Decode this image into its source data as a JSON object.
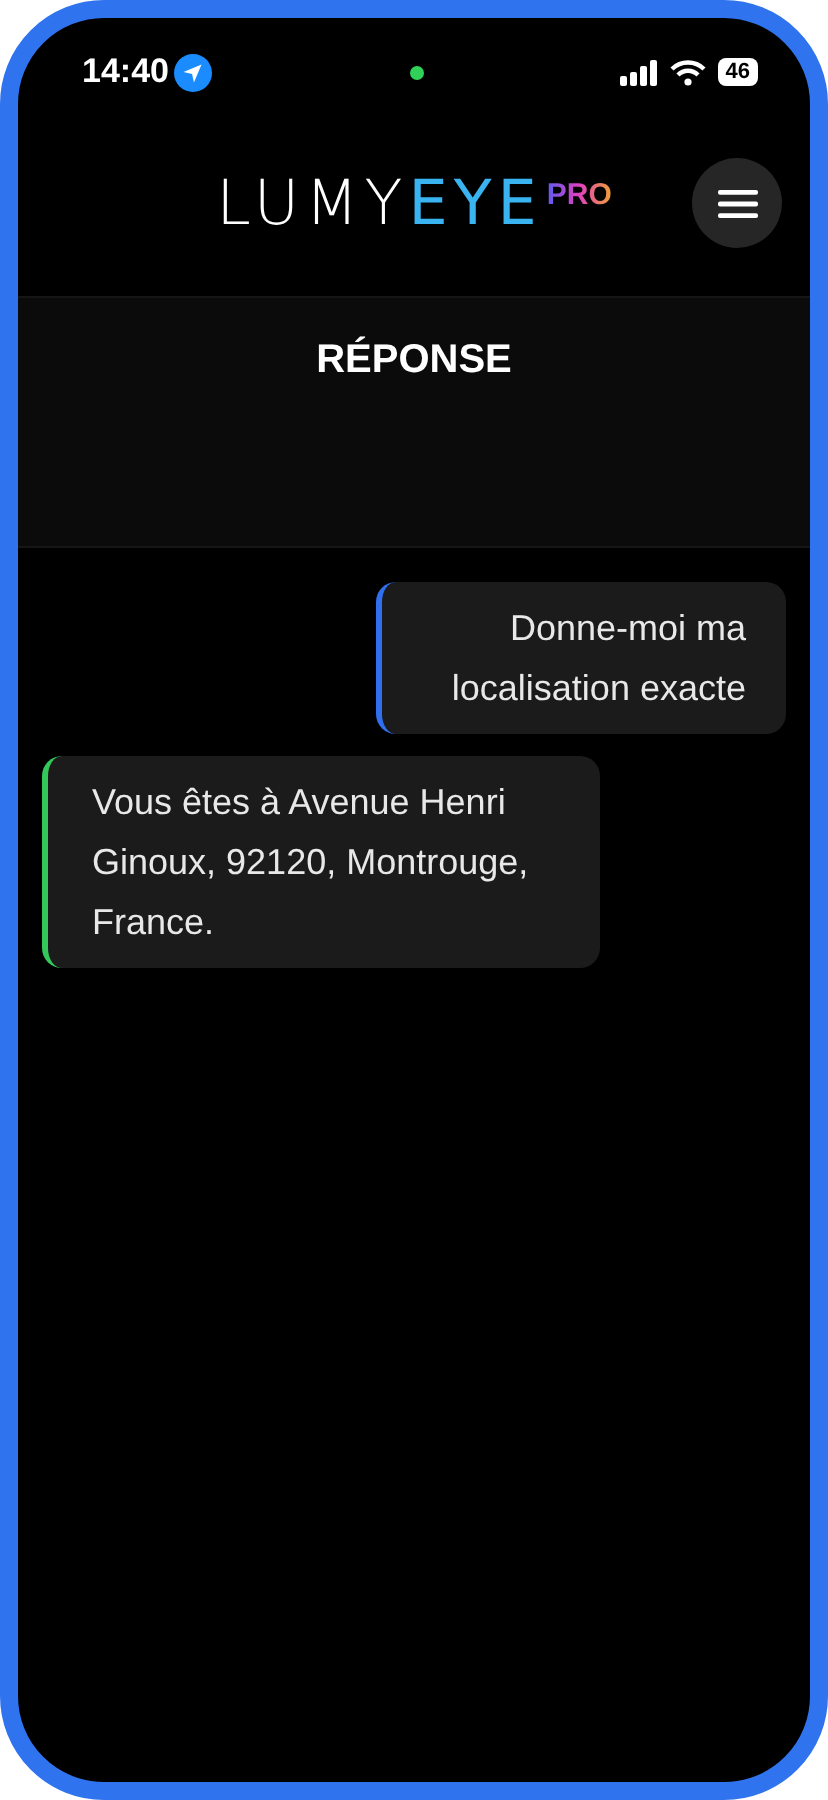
{
  "status_bar": {
    "time": "14:40",
    "battery": "46"
  },
  "logo": {
    "main": "LUMY",
    "accent": "EYE",
    "badge": "PRO"
  },
  "section": {
    "title": "RÉPONSE"
  },
  "messages": [
    {
      "kind": "user",
      "text": "Donne-moi ma localisation exacte",
      "color": "#2f6ff0"
    },
    {
      "kind": "assistant",
      "text": "Vous êtes à Avenue Henri Ginoux, 92120, Montrouge, France.",
      "color": "#34c759"
    }
  ]
}
